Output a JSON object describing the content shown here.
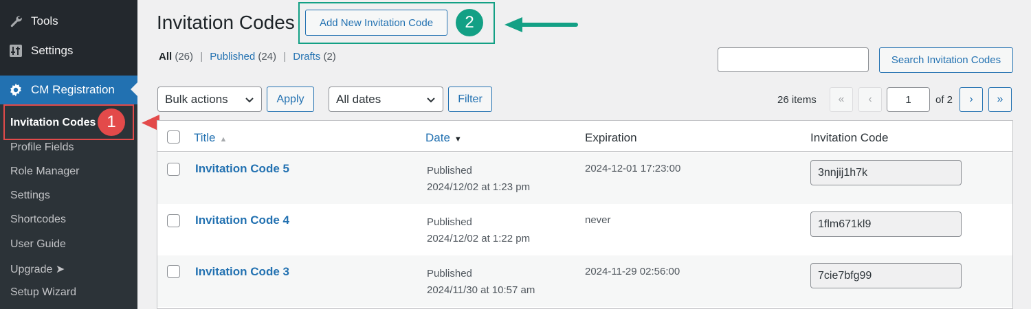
{
  "sidebar": {
    "tools_label": "Tools",
    "settings_label": "Settings",
    "plugin_label": "CM Registration",
    "submenu": [
      {
        "label": "Invitation Codes"
      },
      {
        "label": "Profile Fields"
      },
      {
        "label": "Role Manager"
      },
      {
        "label": "Settings"
      },
      {
        "label": "Shortcodes"
      },
      {
        "label": "User Guide"
      },
      {
        "label": "Upgrade ➤"
      },
      {
        "label": "Setup Wizard"
      }
    ]
  },
  "header": {
    "title": "Invitation Codes",
    "add_new_label": "Add New Invitation Code"
  },
  "annotations": {
    "badge_1": "1",
    "badge_2": "2",
    "red_color": "#e34a4a",
    "green_color": "#13a085"
  },
  "filters": {
    "all_label": "All",
    "all_count": "(26)",
    "published_label": "Published",
    "published_count": "(24)",
    "drafts_label": "Drafts",
    "drafts_count": "(2)",
    "separator": "|"
  },
  "search": {
    "value": "",
    "button_label": "Search Invitation Codes"
  },
  "toolbar": {
    "bulk_actions_selected": "Bulk actions",
    "apply_label": "Apply",
    "dates_selected": "All dates",
    "filter_label": "Filter"
  },
  "pagination": {
    "items_text": "26 items",
    "first": "«",
    "prev": "‹",
    "current_page": "1",
    "of_text": "of 2",
    "next": "›",
    "last": "»"
  },
  "table": {
    "columns": {
      "title": "Title",
      "date": "Date",
      "expiration": "Expiration",
      "code": "Invitation Code"
    },
    "rows": [
      {
        "title": "Invitation Code 5",
        "status": "Published",
        "date": "2024/12/02 at 1:23 pm",
        "expiration": "2024-12-01 17:23:00",
        "code": "3nnjij1h7k"
      },
      {
        "title": "Invitation Code 4",
        "status": "Published",
        "date": "2024/12/02 at 1:22 pm",
        "expiration": "never",
        "code": "1flm671kl9"
      },
      {
        "title": "Invitation Code 3",
        "status": "Published",
        "date": "2024/11/30 at 10:57 am",
        "expiration": "2024-11-29 02:56:00",
        "code": "7cie7bfg99"
      }
    ]
  }
}
